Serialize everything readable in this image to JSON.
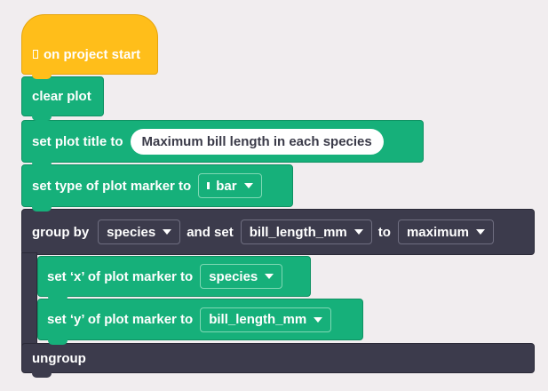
{
  "blocks": {
    "on_start": {
      "label": "on project start",
      "icon": "start-icon"
    },
    "clear_plot": {
      "label": "clear plot"
    },
    "set_title": {
      "label": "set plot title to",
      "value": "Maximum bill length in each species"
    },
    "set_type": {
      "label": "set type of plot marker to",
      "selected": "bar",
      "icon": "bar-icon"
    },
    "group_by": {
      "label": "group by",
      "column": "species",
      "and_set": "and set",
      "field": "bill_length_mm",
      "to": "to",
      "agg": "maximum"
    },
    "set_x": {
      "label": "set ‘x’ of plot marker to",
      "value": "species"
    },
    "set_y": {
      "label": "set ‘y’ of plot marker to",
      "value": "bill_length_mm"
    },
    "ungroup": {
      "label": "ungroup"
    }
  },
  "colors": {
    "background": "#f1edef",
    "event": "#ffbe1a",
    "plot": "#16b07a",
    "data": "#3c3b4c"
  }
}
